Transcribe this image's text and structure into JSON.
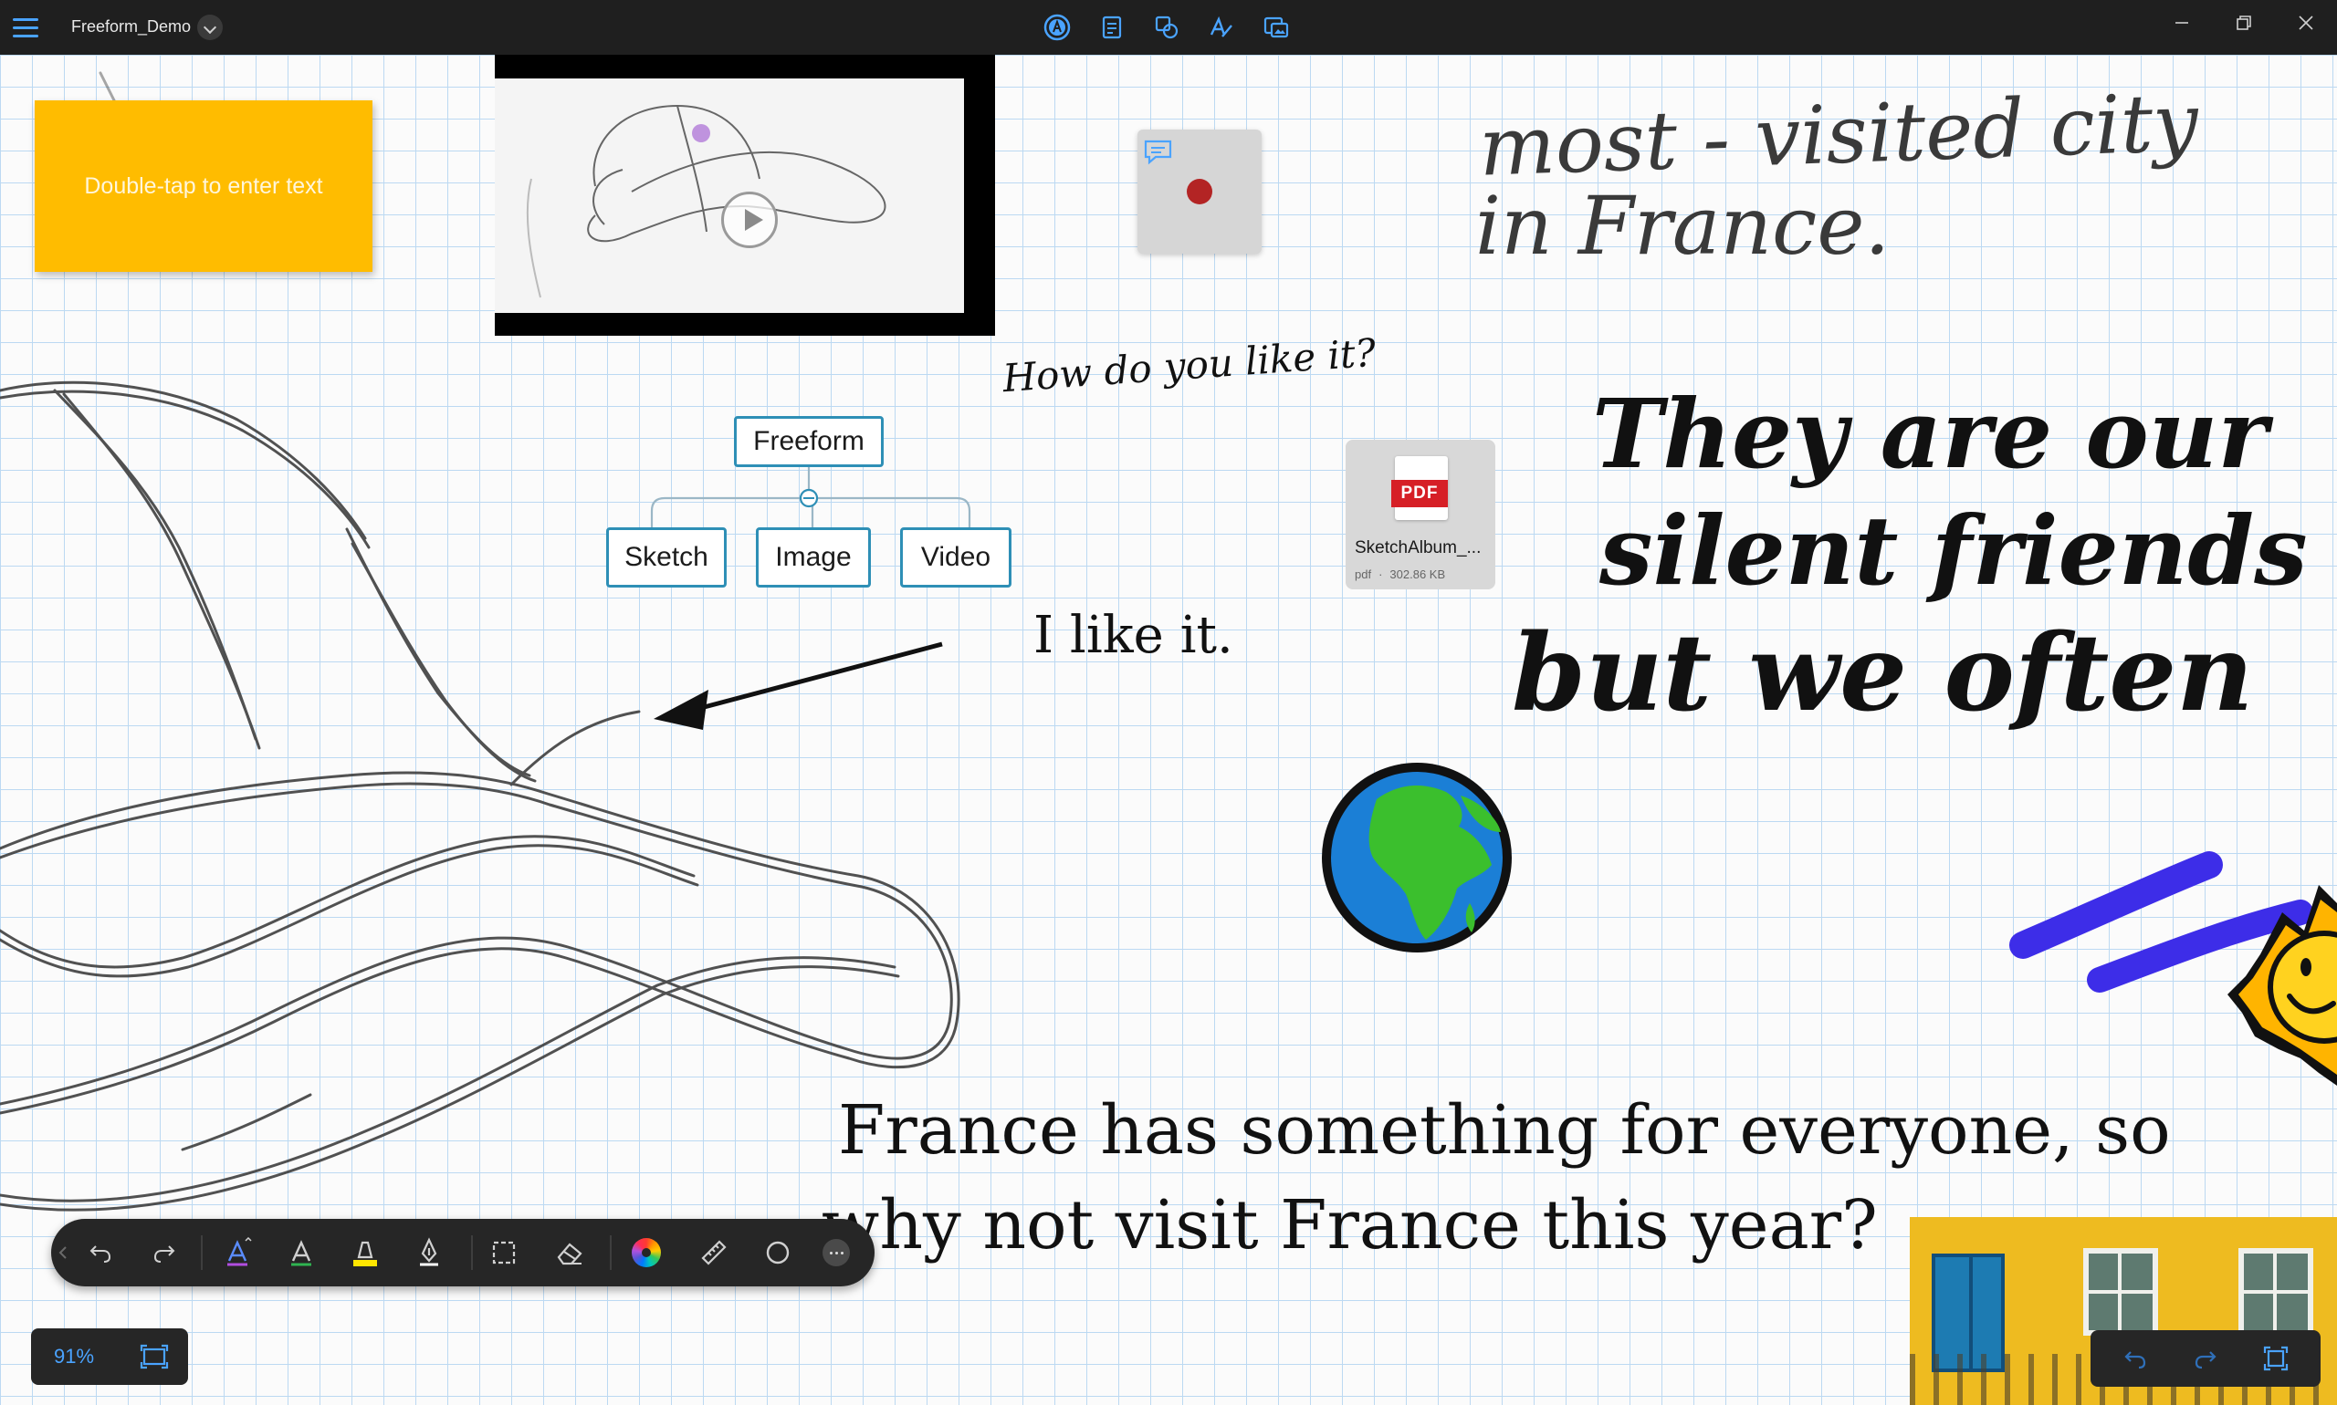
{
  "app": {
    "title": "Freeform_Demo",
    "accent": "#4aa3ff"
  },
  "titlebar_tools": [
    "text-pen-icon",
    "notes-icon",
    "shapes-icon",
    "handwriting-icon",
    "insert-media-icon"
  ],
  "window_controls": [
    "minimize-icon",
    "restore-icon",
    "close-icon"
  ],
  "canvas": {
    "sticky_note": {
      "text": "Double-tap to enter text",
      "color": "#ffbc00"
    },
    "mindmap": {
      "root": "Freeform",
      "children": [
        "Sketch",
        "Image",
        "Video"
      ],
      "border_color": "#2e8fb6"
    },
    "pdf": {
      "badge": "PDF",
      "name": "SketchAlbum_...",
      "type": "pdf",
      "separator": "·",
      "size": "302.86 KB"
    },
    "handwriting": {
      "top_right_l1": "most - visited city",
      "top_right_l2": "in France.",
      "question": "How do you like it?",
      "answer": "I like it.",
      "big_l1": "They are our",
      "big_l2": "silent friends",
      "big_l3": "but we often",
      "bottom_l1": "France  has  something  for everyone, so",
      "bottom_l2": "why  not  visit  France  this  year?"
    }
  },
  "ink_toolbar": {
    "tools": [
      "collapse-icon",
      "undo-icon",
      "redo-icon",
      "pen-icon",
      "pen-green-icon",
      "highlighter-icon",
      "fountain-pen-icon",
      "lasso-select-icon",
      "eraser-icon",
      "color-wheel-icon",
      "ruler-icon",
      "shape-circle-icon",
      "more-icon"
    ]
  },
  "zoom": {
    "value": "91%"
  },
  "history_controls": [
    "undo-icon",
    "redo-icon",
    "select-all-icon"
  ]
}
